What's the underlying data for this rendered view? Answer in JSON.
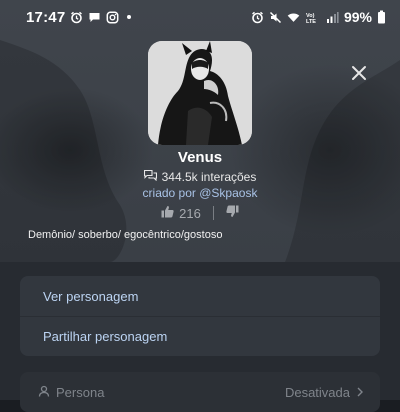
{
  "status_bar": {
    "time": "17:47",
    "battery": "99%",
    "left_icons": [
      "alarm-icon",
      "chat-bubble-icon",
      "instagram-icon",
      "notification-dot"
    ],
    "right_icons": [
      "alarm-icon",
      "mute-icon",
      "wifi-icon",
      "volte-icon",
      "signal-icon",
      "battery-icon"
    ],
    "volte_text": "VoLTE"
  },
  "character": {
    "name": "Venus",
    "interactions": "344.5k interações",
    "creator_prefix": "criado por",
    "creator_handle": "@Skpaosk",
    "likes": "216",
    "description": "Demônio/ soberbo/ egocêntrico/gostoso"
  },
  "menu": {
    "view_label": "Ver personagem",
    "share_label": "Partilhar personagem"
  },
  "persona": {
    "label": "Persona",
    "value": "Desativada"
  },
  "colors": {
    "backdrop": "#3d4249",
    "lower_bg": "#272b31",
    "menu_bg": "#32373e",
    "link": "#bcd4f3",
    "creator": "#a9c2e6"
  }
}
